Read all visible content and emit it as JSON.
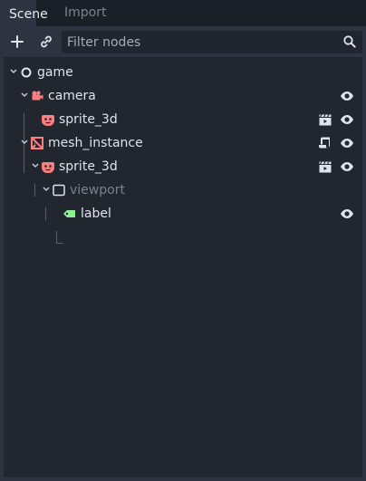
{
  "tabs": [
    {
      "label": "Scene",
      "active": true
    },
    {
      "label": "Import",
      "active": false
    }
  ],
  "toolbar": {
    "add_icon": "plus-icon",
    "link_icon": "link-icon",
    "filter_placeholder": "Filter nodes",
    "filter_value": "",
    "search_icon": "search-icon"
  },
  "tree": [
    {
      "name": "game",
      "icon": "node3d-circle-icon",
      "depth": 0
    },
    {
      "name": "camera",
      "icon": "camera-icon",
      "depth": 1,
      "actions": [
        "visibility-eye-icon"
      ]
    },
    {
      "name": "sprite_3d",
      "icon": "sprite3d-icon",
      "depth": 2,
      "actions": [
        "clapperboard-icon",
        "visibility-eye-icon"
      ]
    },
    {
      "name": "mesh_instance",
      "icon": "mesh-instance-icon",
      "depth": 1,
      "actions": [
        "script-icon",
        "visibility-eye-icon"
      ]
    },
    {
      "name": "sprite_3d",
      "icon": "sprite3d-icon",
      "depth": 2,
      "actions": [
        "clapperboard-icon",
        "visibility-eye-icon"
      ]
    },
    {
      "name": "viewport",
      "icon": "viewport-icon",
      "depth": 3,
      "dimmed": true
    },
    {
      "name": "label",
      "icon": "label-tag-icon",
      "depth": 4,
      "actions": [
        "visibility-eye-icon"
      ]
    }
  ],
  "colors": {
    "accent_red": "#fc7f7f",
    "label_green": "#8eef97",
    "background": "#20252f",
    "panel": "#2d3340"
  }
}
